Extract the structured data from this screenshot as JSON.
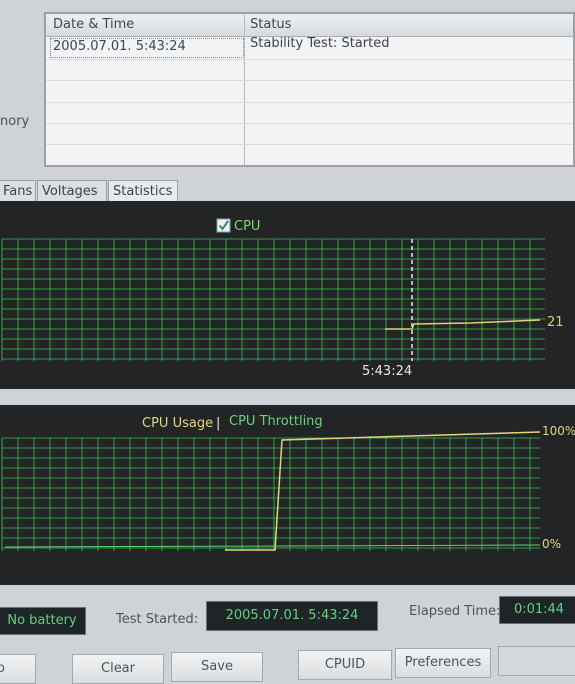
{
  "log": {
    "columns": [
      "Date & Time",
      "Status"
    ],
    "rows": [
      {
        "datetime": "2005.07.01. 5:43:24",
        "status": "Stability Test: Started"
      }
    ]
  },
  "side_label": "nory",
  "tabs": [
    "Fans",
    "Voltages",
    "Statistics"
  ],
  "panel1": {
    "legend": "CPU",
    "checkbox_checked": true,
    "time_label": "5:43:24",
    "value_label": "21",
    "line_color": "#d8d27a",
    "grid_color": "#3fbf4f"
  },
  "panel2": {
    "legend_usage": "CPU Usage",
    "legend_sep": "|",
    "legend_throttling": "CPU Throttling",
    "label_top": "100%",
    "label_bottom": "0%",
    "usage_color": "#e0d77a",
    "throttling_color": "#5fd36f"
  },
  "status": {
    "battery": "No battery",
    "test_started_label": "Test Started:",
    "test_started_value": "2005.07.01. 5:43:24",
    "elapsed_label": "Elapsed Time:",
    "elapsed_value": "0:01:44"
  },
  "buttons": {
    "start": "o",
    "clear": "Clear",
    "save": "Save",
    "cpuid": "CPUID",
    "preferences": "Preferences"
  }
}
